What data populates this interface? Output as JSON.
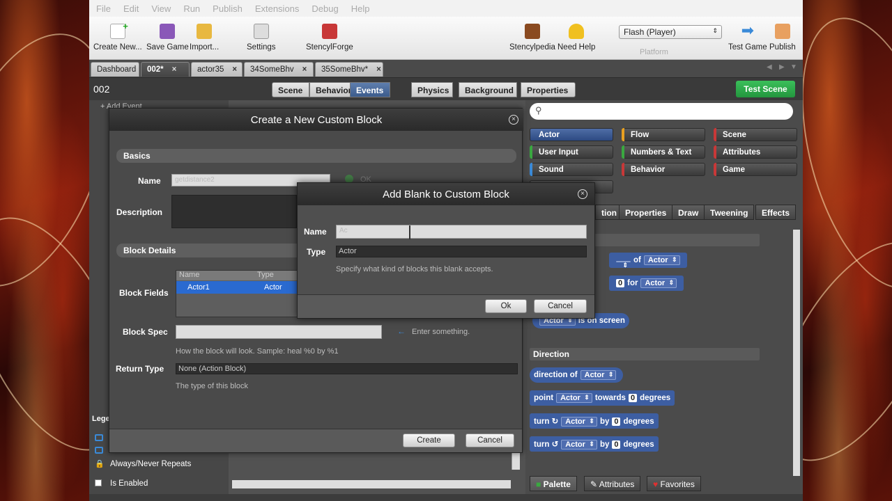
{
  "menu": [
    "File",
    "Edit",
    "View",
    "Run",
    "Publish",
    "Extensions",
    "Debug",
    "Help"
  ],
  "toolbar": {
    "create_new": "Create New...",
    "save_game": "Save Game",
    "import": "Import...",
    "settings": "Settings",
    "stencylforge": "StencylForge",
    "stencylpedia": "Stencylpedia",
    "need_help": "Need Help",
    "platform_value": "Flash (Player)",
    "platform_label": "Platform",
    "test_game": "Test Game",
    "publish": "Publish"
  },
  "tabs": [
    "Dashboard",
    "002*",
    "actor35",
    "34SomeBhv",
    "35SomeBhv*"
  ],
  "scene": {
    "id": "002",
    "modes": [
      "Scene",
      "Behaviors",
      "Events",
      "Physics",
      "Background",
      "Properties"
    ],
    "active_mode": "Events",
    "test_scene": "Test Scene"
  },
  "palette": {
    "categories": [
      "Actor",
      "Flow",
      "Scene",
      "User Input",
      "Numbers & Text",
      "Attributes",
      "Sound",
      "Behavior",
      "Game"
    ],
    "subtabs": [
      "tion",
      "Properties",
      "Draw",
      "Tweening",
      "Effects"
    ],
    "blocks": {
      "of_label": "of",
      "for_label": "for",
      "actor": "Actor",
      "is_on_screen": "is on screen",
      "direction_header": "Direction",
      "direction_of": "direction of",
      "point": "point",
      "towards": "towards",
      "degrees": "degrees",
      "turn": "turn",
      "by": "by",
      "zero": "0"
    },
    "bottom_tabs": [
      "Palette",
      "Attributes",
      "Favorites"
    ]
  },
  "sidebar": {
    "legend": "Lege",
    "always_never": "Always/Never Repeats",
    "is_enabled": "Is Enabled",
    "add_event": "+ Add Event"
  },
  "custom_block_dialog": {
    "title": "Create a New Custom Block",
    "basics": "Basics",
    "name_label": "Name",
    "name_value": "getdistance2",
    "ok_hint": "OK",
    "description_label": "Description",
    "block_details": "Block Details",
    "block_fields_label": "Block Fields",
    "fields_header_name": "Name",
    "fields_header_type": "Type",
    "field_row_name": "Actor1",
    "field_row_type": "Actor",
    "block_spec_label": "Block Spec",
    "block_spec_hint": "Enter something.",
    "block_spec_help": "How the block will look. Sample: heal %0 by %1",
    "return_type_label": "Return Type",
    "return_type_value": "None (Action Block)",
    "return_type_help": "The type of this block",
    "create_button": "Create",
    "cancel_button": "Cancel"
  },
  "add_blank_dialog": {
    "title": "Add Blank to Custom Block",
    "name_label": "Name",
    "name_value": "Ac",
    "type_label": "Type",
    "type_value": "Actor",
    "type_help": "Specify what kind of blocks this blank accepts.",
    "ok_button": "Ok",
    "cancel_button": "Cancel"
  },
  "colors": {
    "accent": "#3c5b8c",
    "green": "#23963e",
    "block_blue": "#3d5ea2"
  }
}
